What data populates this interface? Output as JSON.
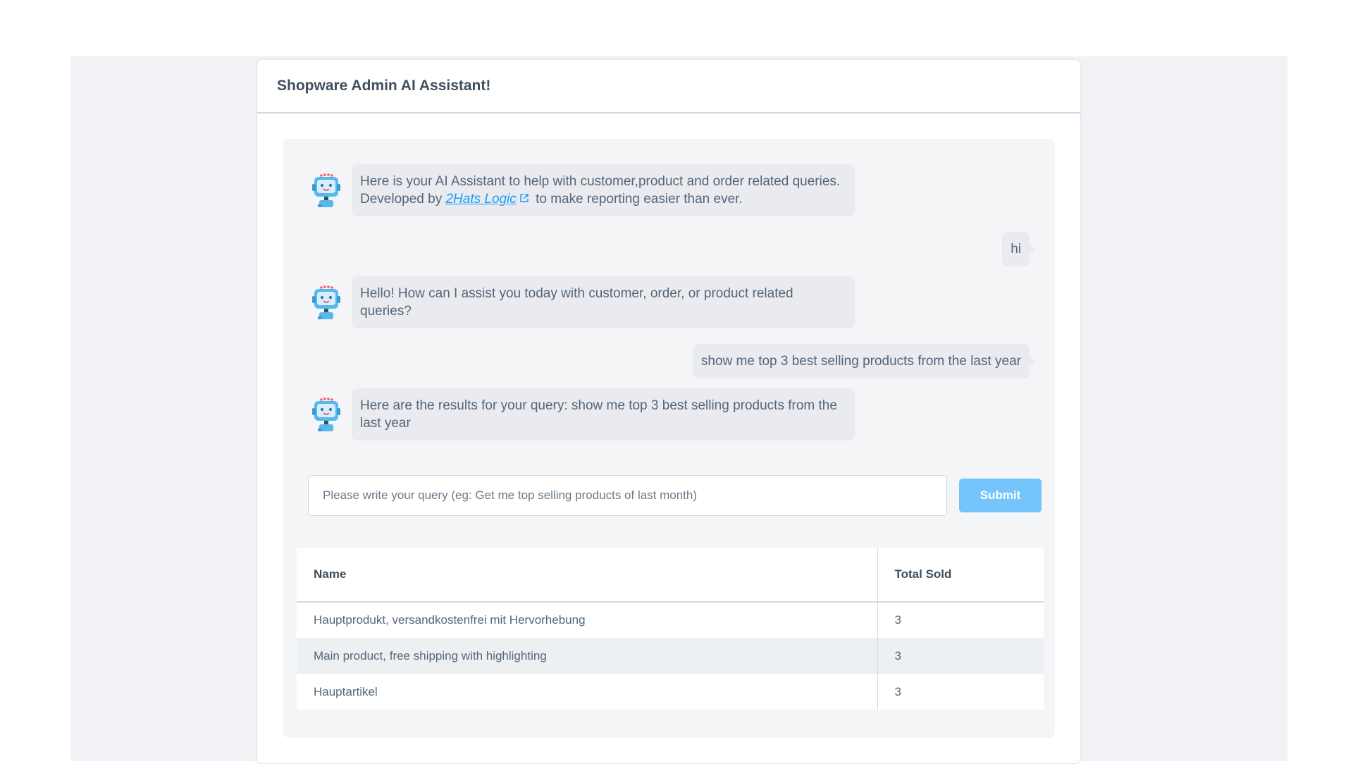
{
  "app": {
    "title": "Shopware Admin AI Assistant!"
  },
  "chat": {
    "intro": {
      "before_link": "Here is your AI Assistant to help with customer,product and order related queries. Developed by ",
      "link_text": "2Hats Logic",
      "after_link": " to make reporting easier than ever."
    },
    "messages": [
      {
        "role": "user",
        "text": "hi"
      },
      {
        "role": "bot",
        "text": "Hello! How can I assist you today with customer, order, or product related queries?"
      },
      {
        "role": "user",
        "text": "show me top 3 best selling products from the last year"
      },
      {
        "role": "bot",
        "text": "Here are the results for your query: show me top 3 best selling products from the last year"
      }
    ],
    "avatar_icon": "robot-icon",
    "link_icon": "external-link-icon"
  },
  "query": {
    "placeholder": "Please write your query (eg: Get me top selling products of last month)",
    "value": "",
    "submit_label": "Submit"
  },
  "results": {
    "columns": [
      "Name",
      "Total Sold"
    ],
    "rows": [
      [
        "Hauptprodukt, versandkostenfrei mit Hervorhebung",
        "3"
      ],
      [
        "Main product, free shipping with highlighting",
        "3"
      ],
      [
        "Hauptartikel",
        "3"
      ]
    ]
  },
  "colors": {
    "accent": "#189eff",
    "submit_button": "#75c4fb",
    "bubble": "#e9ebee",
    "page_background": "#f0f2f5"
  }
}
